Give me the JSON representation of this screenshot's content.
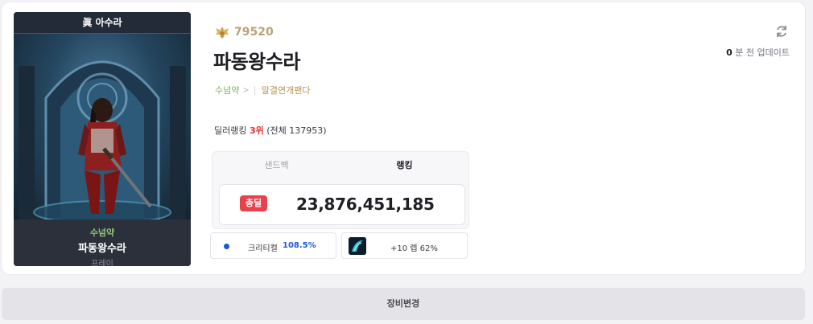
{
  "portrait": {
    "class_icon": "✹",
    "class_title": "眞 아수라",
    "guild": "수넘약",
    "name": "파동왕수라",
    "server": "프레이"
  },
  "profile": {
    "fame_icon": "fame-wings-icon",
    "fame": "79520",
    "name": "파동왕수라",
    "guild": "수넘약",
    "guild_arrow": ">",
    "adventure": "말결연개팬다"
  },
  "update": {
    "count": "0",
    "label": "분 전 업데이트"
  },
  "ranking": {
    "prefix": "딜러랭킹",
    "rank": "3위",
    "total": "(전체 137953)"
  },
  "tabs": [
    "샌드백",
    "랭킹"
  ],
  "active_tab": "랭킹",
  "damage": {
    "badge": "총딜",
    "value": "23,876,451,185"
  },
  "stats": {
    "crit_label": "크리티컬",
    "crit_value": "108.5%",
    "enhance": "+10 렙 62%"
  },
  "equip_button": "장비변경",
  "colors": {
    "accent_red": "#e8414c",
    "crit_blue": "#1a59d6",
    "guild_green": "#7cae5e",
    "fame_gold": "#b9a27a"
  }
}
